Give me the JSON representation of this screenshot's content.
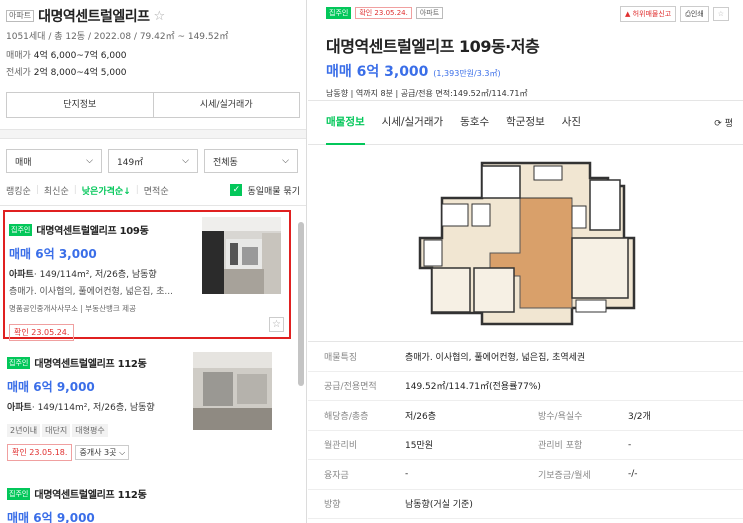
{
  "complex": {
    "tag": "아파트",
    "name": "대명역센트럴엘리프",
    "summary": "1051세대 / 총 12동 / 2022.08 / 79.42㎡ ~ 149.52㎡",
    "sale_label": "매매가",
    "sale_value": "4억 6,000~7억 6,000",
    "lease_label": "전세가",
    "lease_value": "2억 8,000~4억 5,000",
    "btn_info": "단지정보",
    "btn_price": "시세/실거래가"
  },
  "filters": {
    "trade": "매매",
    "area": "149㎡",
    "dong": "전체동"
  },
  "sort": {
    "rank": "랭킹순",
    "latest": "최신순",
    "low_price": "낮은가격순↓",
    "area": "면적순",
    "group": "동일매물 묶기"
  },
  "listings": [
    {
      "tag": "집주인",
      "name": "대명역센트럴엘리프 109동",
      "price": "매매 6억 3,000",
      "type": "아파트",
      "info": "· 149/114m², 저/26층, 남동향",
      "desc": "층매가. 이사협의, 풀에어컨형, 넓은집, 초...",
      "agent": "명품공인중개사사무소 | 부동산뱅크 제공",
      "confirm": "확인 23.05.24."
    },
    {
      "tag": "집주인",
      "name": "대명역센트럴엘리프 112동",
      "price": "매매 6억 9,000",
      "type": "아파트",
      "info": "· 149/114m², 저/26층, 남동향",
      "pills": [
        "2년이내",
        "대단지",
        "대형평수"
      ],
      "confirm": "확인 23.05.18.",
      "brokers": "중개사 3곳"
    },
    {
      "tag": "집주인",
      "name": "대명역센트럴엘리프 112동",
      "price": "매매 6억 9,000"
    }
  ],
  "detail": {
    "tag_owner": "집주인",
    "tag_confirm": "확인 23.05.24.",
    "tag_type": "아파트",
    "report": "허위매물신고",
    "print": "인쇄",
    "title": "대명역센트럴엘리프 109동·저층",
    "price": "매매 6억 3,000",
    "price_per": "(1,393만원/3.3㎡)",
    "info": "남동향 | 역까지 8분 | 공급/전용 면적:149.52㎡/114.71㎡",
    "tabs": [
      "매물정보",
      "시세/실거래가",
      "동호수",
      "학군정보",
      "사진"
    ],
    "tab_more": "평",
    "rows": [
      {
        "k": "매물특징",
        "v": "층매가. 이사협의, 풀에어컨형, 넓은집, 초역세권"
      },
      {
        "k": "공급/전용면적",
        "v": "149.52㎡/114.71㎡(전용률77%)"
      },
      {
        "k": "해당층/총층",
        "v": "저/26층",
        "k2": "방수/욕실수",
        "v2": "3/2개"
      },
      {
        "k": "월관리비",
        "v": "15만원",
        "k2": "관리비 포함",
        "v2": "-"
      },
      {
        "k": "융자금",
        "v": "-",
        "k2": "기보증금/월세",
        "v2": "-/-"
      },
      {
        "k": "방향",
        "v": "남동향(거실 기준)"
      }
    ]
  },
  "colors": {
    "green": "#03c75a",
    "blue": "#3a6ee8",
    "red": "#e02020"
  },
  "icons": [
    "star-icon",
    "chevron-down-icon",
    "check-icon",
    "siren-icon",
    "print-icon",
    "refresh-icon"
  ]
}
